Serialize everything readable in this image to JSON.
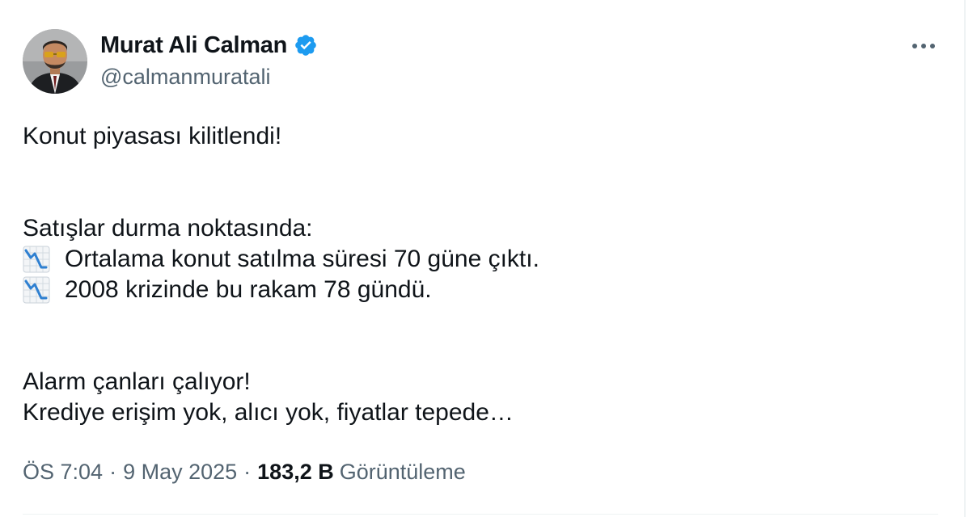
{
  "author": {
    "display_name": "Murat Ali Calman",
    "handle": "@calmanmuratali",
    "verified": true
  },
  "tweet": {
    "lines": {
      "l1": "Konut piyasası kilitlendi!",
      "l2": "Satışlar durma noktasında:",
      "l3": "Ortalama konut satılma süresi 70 güne çıktı.",
      "l4": "2008 krizinde bu rakam 78 gündü.",
      "l5": "Alarm çanları çalıyor!",
      "l6": "Krediye erişim yok, alıcı yok, fiyatlar tepede…"
    },
    "bullet_icon": "chart-decreasing-emoji"
  },
  "meta": {
    "time": "ÖS 7:04",
    "date": "9 May 2025",
    "separator": "·",
    "views_count": "183,2 B",
    "views_label": "Görüntüleme"
  },
  "icons": {
    "more": "more-horizontal-icon",
    "verified": "verified-badge-icon"
  },
  "colors": {
    "text": "#0f1419",
    "secondary": "#536471",
    "verified_blue": "#1d9bf0",
    "divider": "#eff3f4"
  }
}
